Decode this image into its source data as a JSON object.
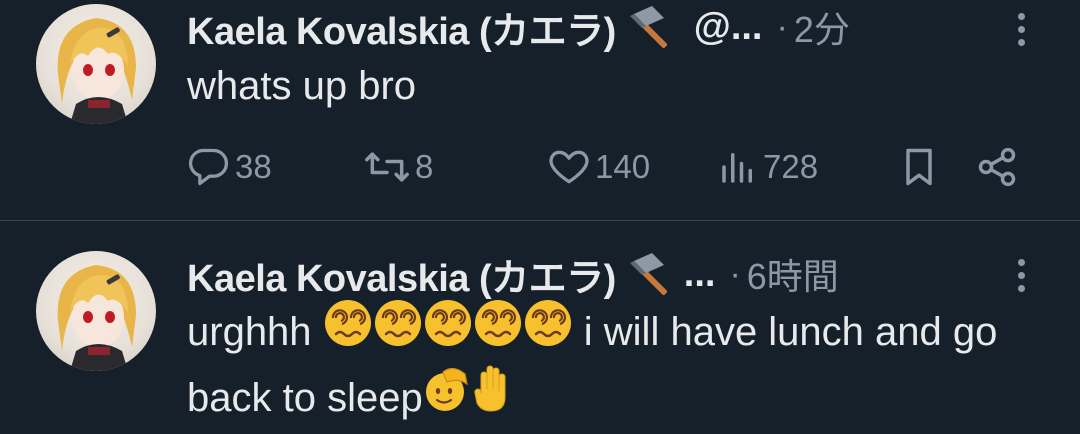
{
  "tweets": [
    {
      "display_name": "Kaela Kovalskia (カエラ)",
      "handle": "@...",
      "time": "2分",
      "text": "whats up bro",
      "emoji_after_text": [],
      "stats": {
        "replies": "38",
        "retweets": "8",
        "likes": "140",
        "views": "728"
      }
    },
    {
      "display_name": "Kaela Kovalskia (カエラ)",
      "handle": "...",
      "time": "6時間",
      "text_parts": [
        "urghhh ",
        " i will have lunch and go back to sleep"
      ],
      "emoji_dizzy_count": 5,
      "emoji_trailing": [
        "saluting-face",
        "raised-hand"
      ]
    }
  ],
  "icons": {
    "hammer": "hammer-icon",
    "reply": "reply-icon",
    "retweet": "retweet-icon",
    "like": "heart-icon",
    "views": "views-icon",
    "bookmark": "bookmark-icon",
    "share": "share-icon",
    "more": "more-icon"
  },
  "colors": {
    "background": "#15202b",
    "text": "#e7e9ea",
    "secondary": "#8b98a5",
    "divider": "#38444d"
  }
}
